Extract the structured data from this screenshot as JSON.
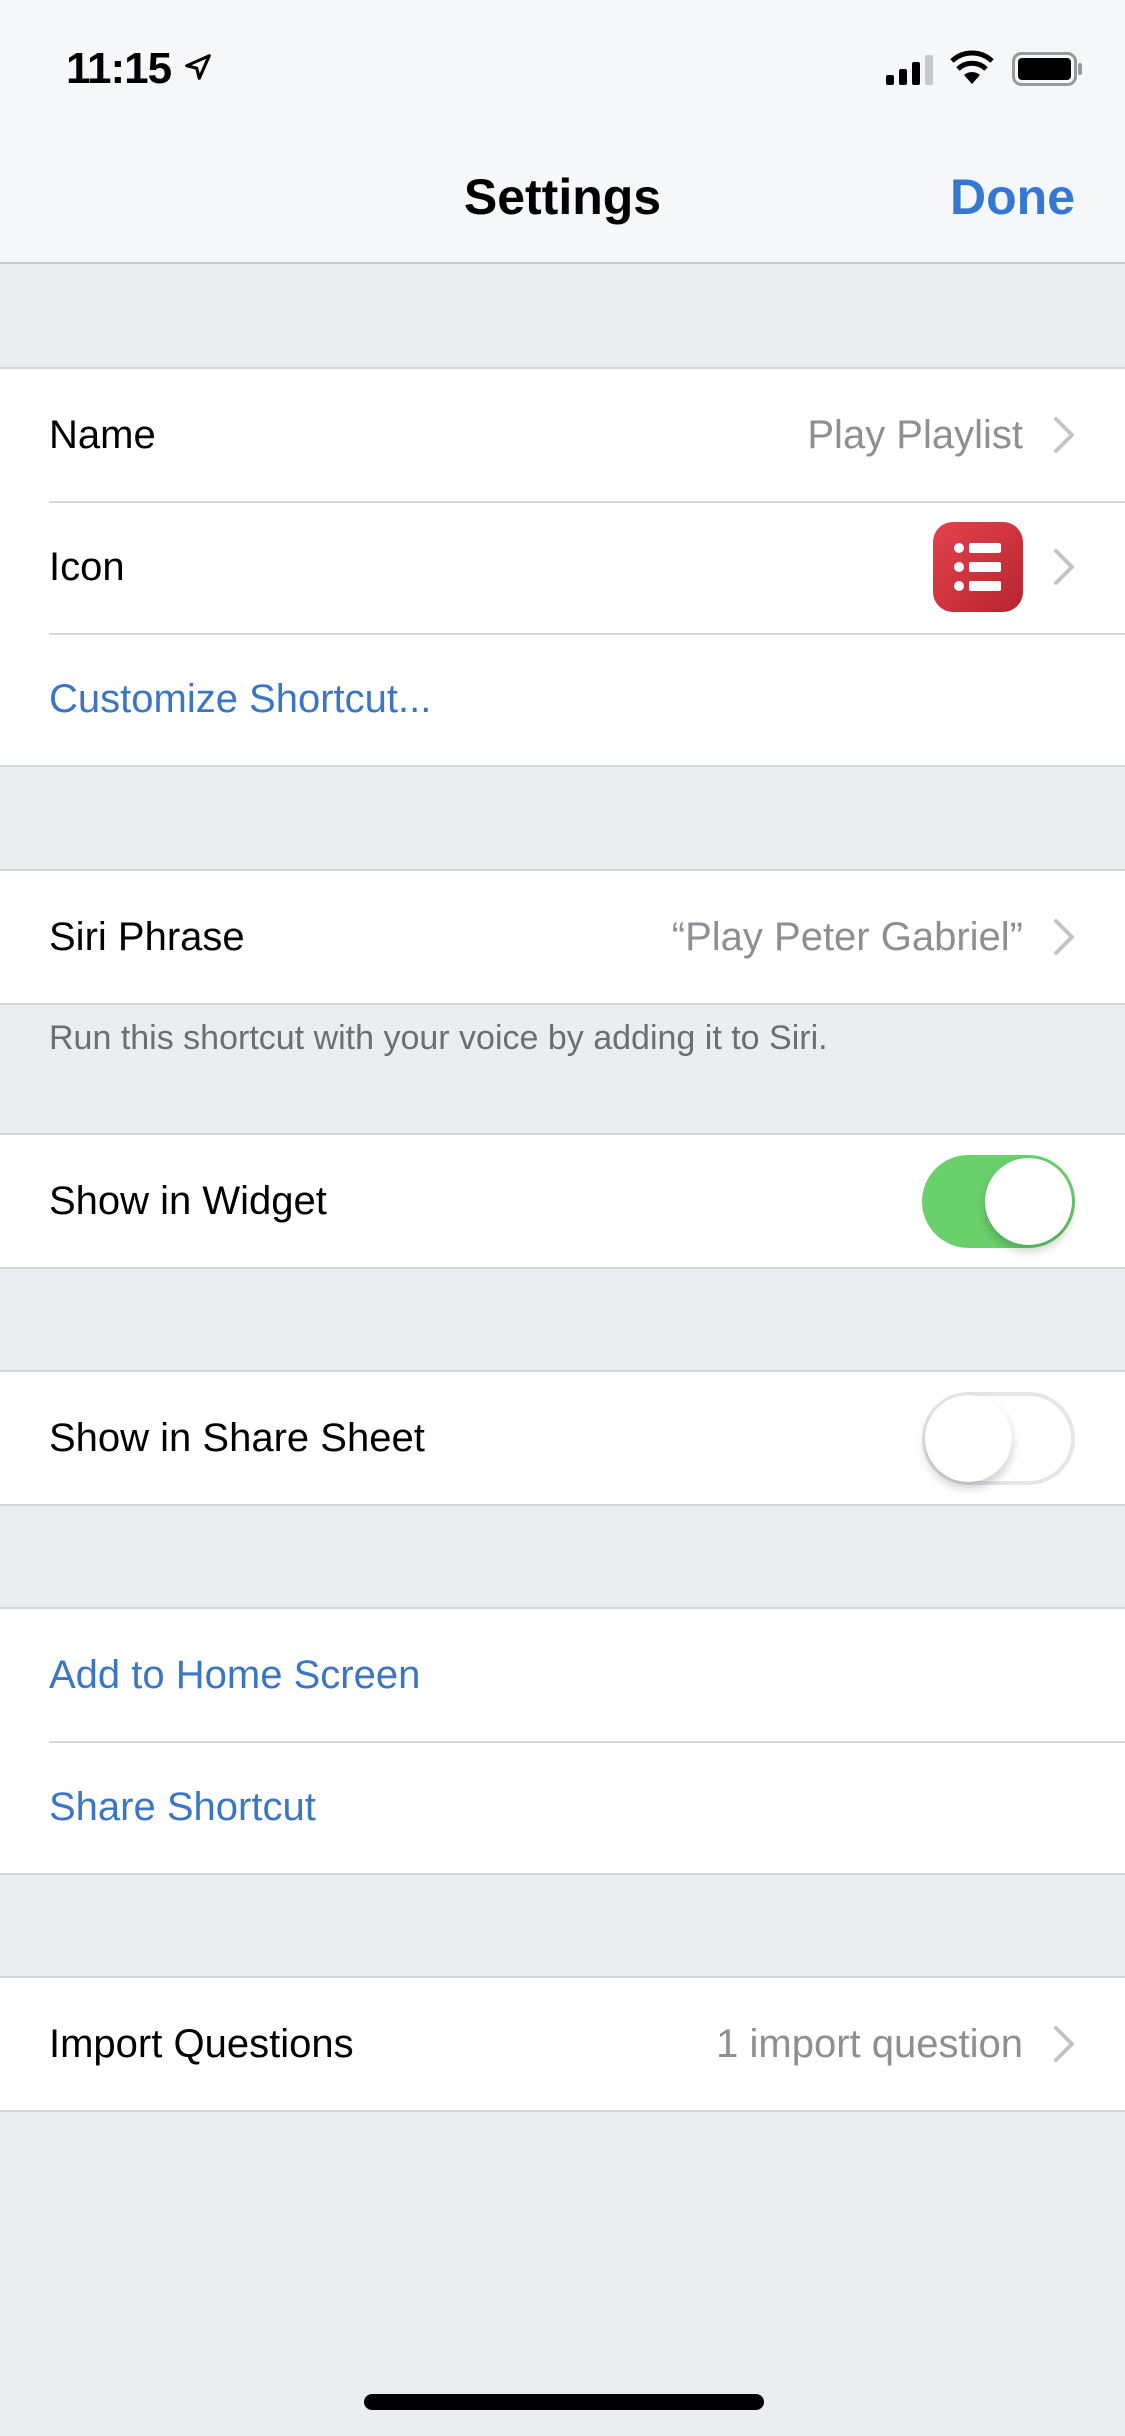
{
  "status_bar": {
    "time": "11:15",
    "icons": [
      "location-arrow-icon",
      "cellular-signal-icon",
      "wifi-icon",
      "battery-icon"
    ]
  },
  "nav": {
    "title": "Settings",
    "done_label": "Done"
  },
  "sections": {
    "general": {
      "name_label": "Name",
      "name_value": "Play Playlist",
      "icon_label": "Icon",
      "icon_color": "#d8333e",
      "customize_label": "Customize Shortcut..."
    },
    "siri": {
      "label": "Siri Phrase",
      "value": "“Play Peter Gabriel”",
      "footer": "Run this shortcut with your voice by adding it to Siri."
    },
    "widget": {
      "label": "Show in Widget",
      "enabled": true
    },
    "share_sheet": {
      "label": "Show in Share Sheet",
      "enabled": false
    },
    "actions": {
      "add_home_label": "Add to Home Screen",
      "share_label": "Share Shortcut"
    },
    "import": {
      "label": "Import Questions",
      "value": "1 import question"
    }
  },
  "colors": {
    "accent": "#3478d4",
    "toggle_on": "#6ad06c",
    "background": "#ebeef1"
  }
}
